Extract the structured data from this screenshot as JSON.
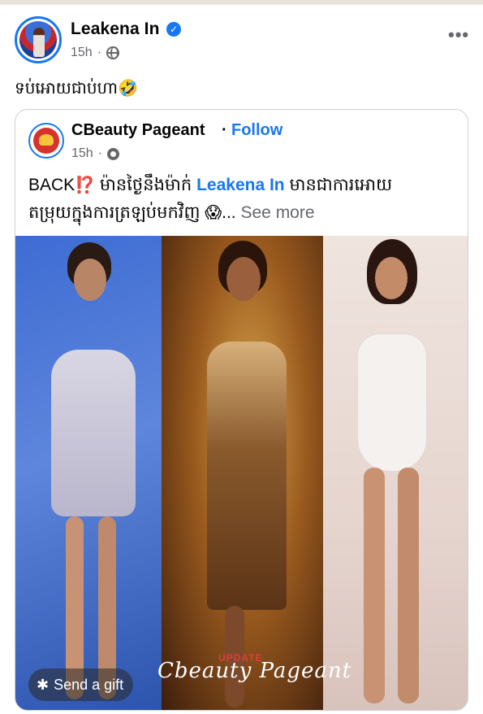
{
  "post": {
    "author": "Leakena In",
    "time": "15h",
    "separator": "·",
    "more_label": "•••",
    "caption": "ទប់អោយជាប់ហា🤣"
  },
  "shared": {
    "page_name": "CBeauty Pageant",
    "separator": "·",
    "follow_label": "Follow",
    "time": "15h",
    "text_prefix": "BACK",
    "text_prefix_emoji": "⁉️",
    "text_line1_mid": " ម៉ានថ្ងៃនឹងម៉ាក់ ",
    "mention": "Leakena In",
    "text_line1_end": " មានជាការអោយ",
    "text_line2": "តម្រុយក្នុងការត្រឡប់មកវិញ ",
    "text_line2_emoji": "😱",
    "ellipsis": "...",
    "see_more": " See more"
  },
  "photo": {
    "watermark": "Cbeauty Pageant",
    "watermark_tag": "UPDATE"
  },
  "gift": {
    "label": "Send a gift",
    "icon": "gift-icon"
  },
  "colors": {
    "accent": "#1877f2",
    "muted": "#65676b"
  }
}
